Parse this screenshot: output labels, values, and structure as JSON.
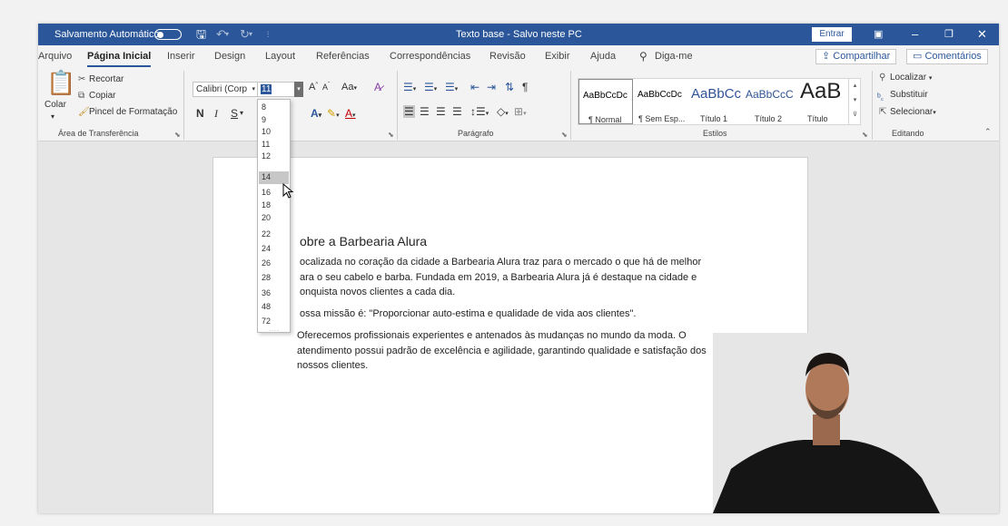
{
  "titlebar": {
    "autosave_label": "Salvamento Automático",
    "doc_title": "Texto base - Salvo neste PC",
    "signin_label": "Entrar",
    "accent": "#2b579a"
  },
  "menu": {
    "tabs": [
      "Arquivo",
      "Página Inicial",
      "Inserir",
      "Design",
      "Layout",
      "Referências",
      "Correspondências",
      "Revisão",
      "Exibir",
      "Ajuda"
    ],
    "tell_me": "Diga-me",
    "share": "Compartilhar",
    "comments": "Comentários"
  },
  "clipboard": {
    "paste": "Colar",
    "cut": "Recortar",
    "copy": "Copiar",
    "format_painter": "Pincel de Formatação",
    "group": "Área de Transferência"
  },
  "font": {
    "name": "Calibri (Corp",
    "size": "11",
    "grow": "A",
    "shrink": "A",
    "case": "Aa",
    "bold": "N",
    "italic": "I",
    "underline": "S",
    "size_options": [
      "8",
      "9",
      "10",
      "11",
      "12",
      "14",
      "16",
      "18",
      "20",
      "22",
      "24",
      "26",
      "28",
      "36",
      "48",
      "72"
    ],
    "highlighted_size": "14"
  },
  "paragraph": {
    "group": "Parágrafo"
  },
  "styles": {
    "group": "Estilos",
    "items": [
      {
        "preview": "AaBbCcDc",
        "name": "¶ Normal"
      },
      {
        "preview": "AaBbCcDc",
        "name": "¶ Sem Esp..."
      },
      {
        "preview": "AaBbCc",
        "name": "Título 1"
      },
      {
        "preview": "AaBbCcC",
        "name": "Título 2"
      },
      {
        "preview": "AaB",
        "name": "Título"
      }
    ]
  },
  "editing": {
    "group": "Editando",
    "find": "Localizar",
    "replace": "Substituir",
    "select": "Selecionar"
  },
  "document": {
    "heading": "obre a Barbearia Alura",
    "para1": [
      "ocalizada no coração da cidade a Barbearia Alura traz para o mercado o que há de melhor",
      "ara o seu cabelo e barba. Fundada em 2019, a Barbearia Alura já é destaque na cidade e",
      "onquista novos clientes a cada dia."
    ],
    "para2": "ossa missão é: \"Proporcionar auto-estima e qualidade de vida aos clientes\".",
    "para3": [
      "Oferecemos profissionais experientes e antenados às mudanças no mundo da moda. O",
      "atendimento possui padrão de excelência e agilidade, garantindo qualidade e satisfação dos",
      "nossos clientes."
    ]
  }
}
